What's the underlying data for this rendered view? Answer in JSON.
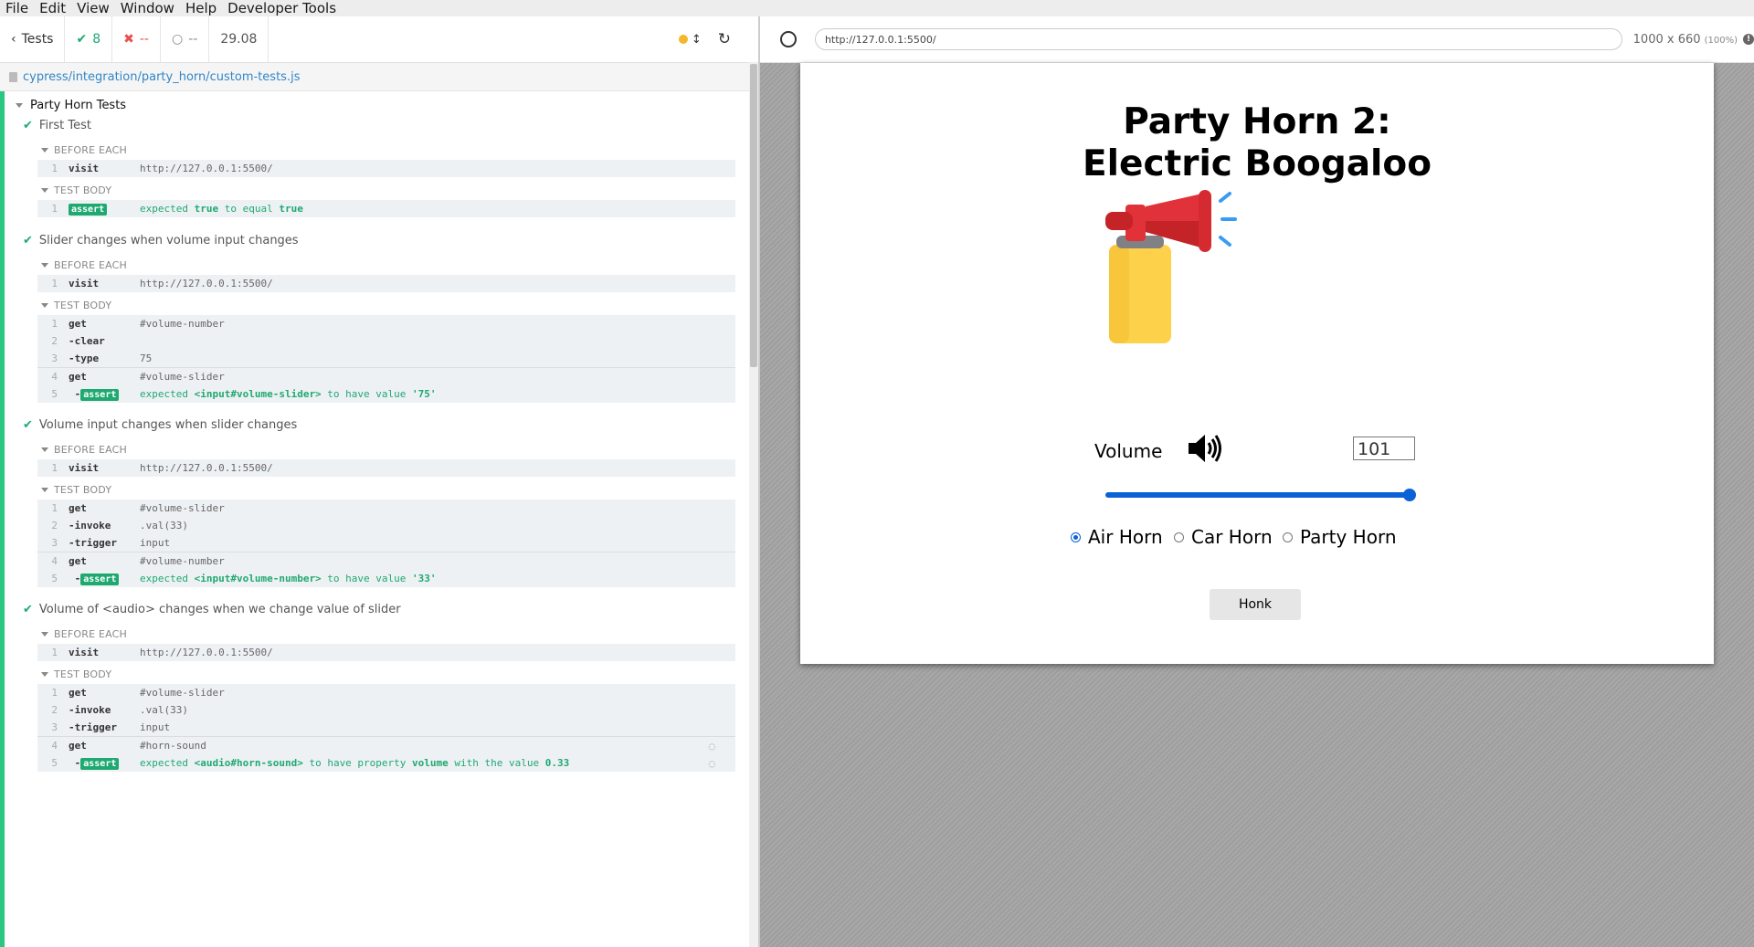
{
  "menu": [
    "File",
    "Edit",
    "View",
    "Window",
    "Help",
    "Developer Tools"
  ],
  "stats": {
    "tests_label": "Tests",
    "passed": "8",
    "failed": "--",
    "pending": "--",
    "duration": "29.08"
  },
  "spec_file": "cypress/integration/party_horn/custom-tests.js",
  "suite_title": "Party Horn Tests",
  "tests": [
    {
      "title": "First Test",
      "before_label": "BEFORE EACH",
      "before": [
        {
          "num": "1",
          "name": "visit",
          "msg": "http://127.0.0.1:5500/"
        }
      ],
      "body_label": "TEST BODY",
      "body": [
        {
          "num": "1",
          "name": "assert",
          "msg_pre": "expected ",
          "msg_b1": "true",
          "msg_mid": " to equal ",
          "msg_b2": "true"
        }
      ]
    },
    {
      "title": "Slider changes when volume input changes",
      "before_label": "BEFORE EACH",
      "before": [
        {
          "num": "1",
          "name": "visit",
          "msg": "http://127.0.0.1:5500/"
        }
      ],
      "body_label": "TEST BODY",
      "body": [
        {
          "num": "1",
          "name": "get",
          "msg": "#volume-number"
        },
        {
          "num": "2",
          "name": "-clear",
          "msg": ""
        },
        {
          "num": "3",
          "name": "-type",
          "msg": "75"
        },
        {
          "num": "4",
          "name": "get",
          "msg": "#volume-slider"
        },
        {
          "num": "5",
          "name": "-assert",
          "msg_pre": "expected ",
          "msg_b1": "<input#volume-slider>",
          "msg_mid": " to have value ",
          "msg_b2": "'75'"
        }
      ]
    },
    {
      "title": "Volume input changes when slider changes",
      "before_label": "BEFORE EACH",
      "before": [
        {
          "num": "1",
          "name": "visit",
          "msg": "http://127.0.0.1:5500/"
        }
      ],
      "body_label": "TEST BODY",
      "body": [
        {
          "num": "1",
          "name": "get",
          "msg": "#volume-slider"
        },
        {
          "num": "2",
          "name": "-invoke",
          "msg": ".val(33)"
        },
        {
          "num": "3",
          "name": "-trigger",
          "msg": "input"
        },
        {
          "num": "4",
          "name": "get",
          "msg": "#volume-number"
        },
        {
          "num": "5",
          "name": "-assert",
          "msg_pre": "expected ",
          "msg_b1": "<input#volume-number>",
          "msg_mid": " to have value ",
          "msg_b2": "'33'"
        }
      ]
    },
    {
      "title": "Volume of <audio> changes when we change value of slider",
      "before_label": "BEFORE EACH",
      "before": [
        {
          "num": "1",
          "name": "visit",
          "msg": "http://127.0.0.1:5500/"
        }
      ],
      "body_label": "TEST BODY",
      "body": [
        {
          "num": "1",
          "name": "get",
          "msg": "#volume-slider"
        },
        {
          "num": "2",
          "name": "-invoke",
          "msg": ".val(33)"
        },
        {
          "num": "3",
          "name": "-trigger",
          "msg": "input"
        },
        {
          "num": "4",
          "name": "get",
          "msg": "#horn-sound"
        },
        {
          "num": "5",
          "name": "-assert",
          "msg_pre": "expected ",
          "msg_b1": "<audio#horn-sound>",
          "msg_mid": " to have property ",
          "msg_b2": "volume",
          "msg_post": " with the value ",
          "msg_b3": "0.33"
        }
      ]
    }
  ],
  "browser": {
    "url": "http://127.0.0.1:5500/",
    "viewport": "1000 x 660",
    "zoom": "(100%)"
  },
  "app": {
    "title_line1": "Party Horn 2:",
    "title_line2": "Electric Boogaloo",
    "volume_label": "Volume",
    "volume_value": "101",
    "slider_level": 1.0,
    "radios": [
      {
        "label": "Air Horn",
        "checked": true
      },
      {
        "label": "Car Horn",
        "checked": false
      },
      {
        "label": "Party Horn",
        "checked": false
      }
    ],
    "honk_label": "Honk"
  },
  "colors": {
    "pass": "#1fa971",
    "fail": "#e94f4f",
    "accent": "#0b61d6",
    "link": "#3386c7"
  }
}
